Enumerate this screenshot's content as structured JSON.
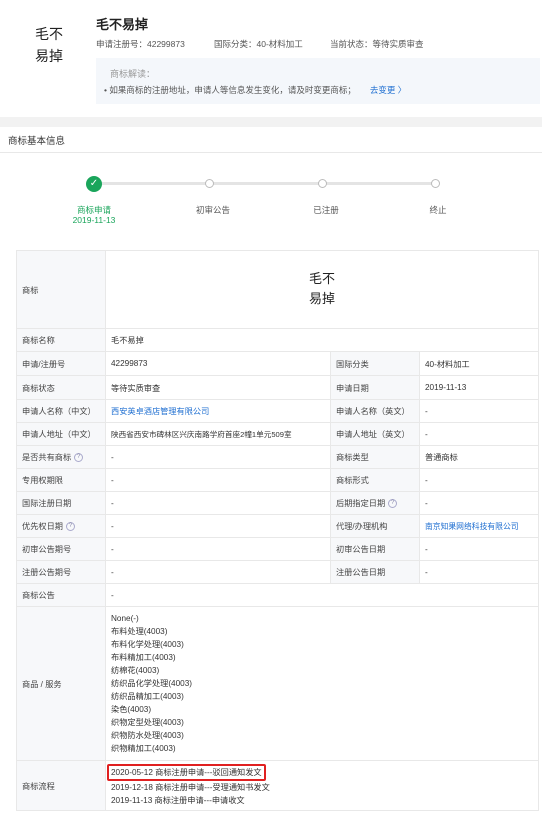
{
  "header": {
    "logo_line1": "毛不",
    "logo_line2": "易掉",
    "name": "毛不易掉",
    "reg_no": "申请注册号：42299873",
    "intl_class": "国际分类：40-材料加工",
    "status": "当前状态：等待实质审查"
  },
  "hint": {
    "title": "商标解读：",
    "text": "• 如果商标的注册地址，申请人等信息发生变化，请及时变更商标；",
    "link": "去变更 〉"
  },
  "section_title": "商标基本信息",
  "steps": [
    {
      "label": "商标申请",
      "date": "2019-11-13"
    },
    {
      "label": "初审公告"
    },
    {
      "label": "已注册"
    },
    {
      "label": "终止"
    }
  ],
  "table": {
    "tm_label": "商标",
    "tm_line1": "毛不",
    "tm_line2": "易掉",
    "rows": [
      {
        "k1": "商标名称",
        "v1": "毛不易掉"
      },
      {
        "k1": "申请/注册号",
        "v1": "42299873",
        "k2": "国际分类",
        "v2": "40-材料加工"
      },
      {
        "k1": "商标状态",
        "v1": "等待实质审查",
        "k2": "申请日期",
        "v2": "2019-11-13"
      },
      {
        "k1": "申请人名称（中文）",
        "v1": "西安英卓酒店管理有限公司",
        "k2": "申请人名称（英文）",
        "v2": "-"
      },
      {
        "k1": "申请人地址（中文）",
        "v1": "陕西省西安市碑林区兴庆南路学府首座2幢1单元509室",
        "k2": "申请人地址（英文）",
        "v2": "-"
      },
      {
        "k1": "是否共有商标",
        "v1": "-",
        "k2": "商标类型",
        "v2": "普通商标"
      },
      {
        "k1": "专用权期限",
        "v1": "-",
        "k2": "商标形式",
        "v2": "-"
      },
      {
        "k1": "国际注册日期",
        "v1": "-",
        "k2": "后期指定日期",
        "v2": "-"
      },
      {
        "k1": "优先权日期",
        "v1": "-",
        "k2": "代理/办理机构",
        "v2": "南京知果网络科技有限公司"
      },
      {
        "k1": "初审公告期号",
        "v1": "-",
        "k2": "初审公告日期",
        "v2": "-"
      },
      {
        "k1": "注册公告期号",
        "v1": "-",
        "k2": "注册公告日期",
        "v2": "-"
      },
      {
        "k1": "商标公告",
        "v1": "-"
      }
    ],
    "goods_label": "商品 / 服务",
    "goods": [
      "None(-)",
      "布料处理(4003)",
      "布料化学处理(4003)",
      "布料精加工(4003)",
      "纺棉花(4003)",
      "纺织品化学处理(4003)",
      "纺织品精加工(4003)",
      "染色(4003)",
      "织物定型处理(4003)",
      "织物防水处理(4003)",
      "织物精加工(4003)"
    ],
    "flow_label": "商标流程",
    "flow": [
      "2020-05-12 商标注册申请---驳回通知发文",
      "2019-12-18 商标注册申请---受理通知书发文",
      "2019-11-13 商标注册申请---申请收文"
    ]
  }
}
